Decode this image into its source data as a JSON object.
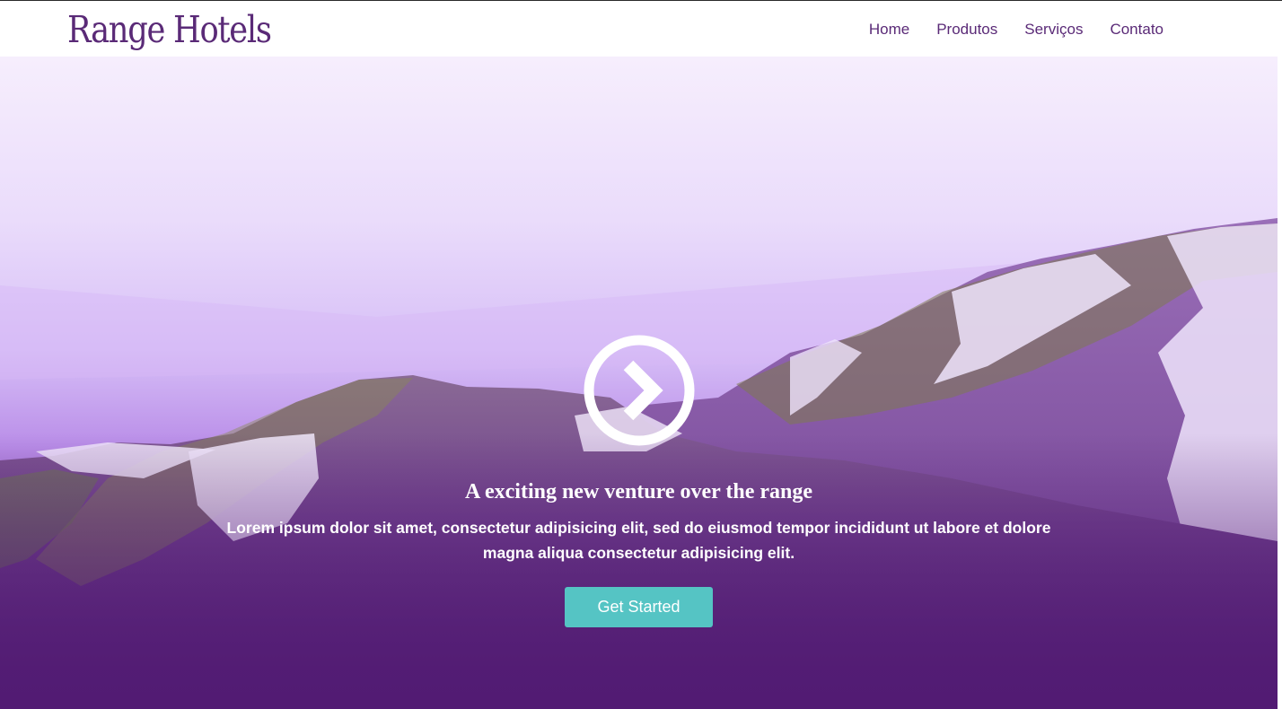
{
  "header": {
    "logo": "Range Hotels",
    "nav": [
      "Home",
      "Produtos",
      "Serviços",
      "Contato"
    ]
  },
  "hero": {
    "play_icon": "chevron-right-circle-icon",
    "headline": "A exciting new venture over the range",
    "lead": "Lorem ipsum dolor sit amet, consectetur adipisicing elit, sed do eiusmod tempor incididunt ut labore et dolore magna aliqua consectetur adipisicing elit.",
    "cta": "Get Started"
  },
  "colors": {
    "brand": "#5a2a77",
    "hero_top": "#f6eefd",
    "hero_bottom": "#531c74",
    "cta": "#55c4c4"
  }
}
